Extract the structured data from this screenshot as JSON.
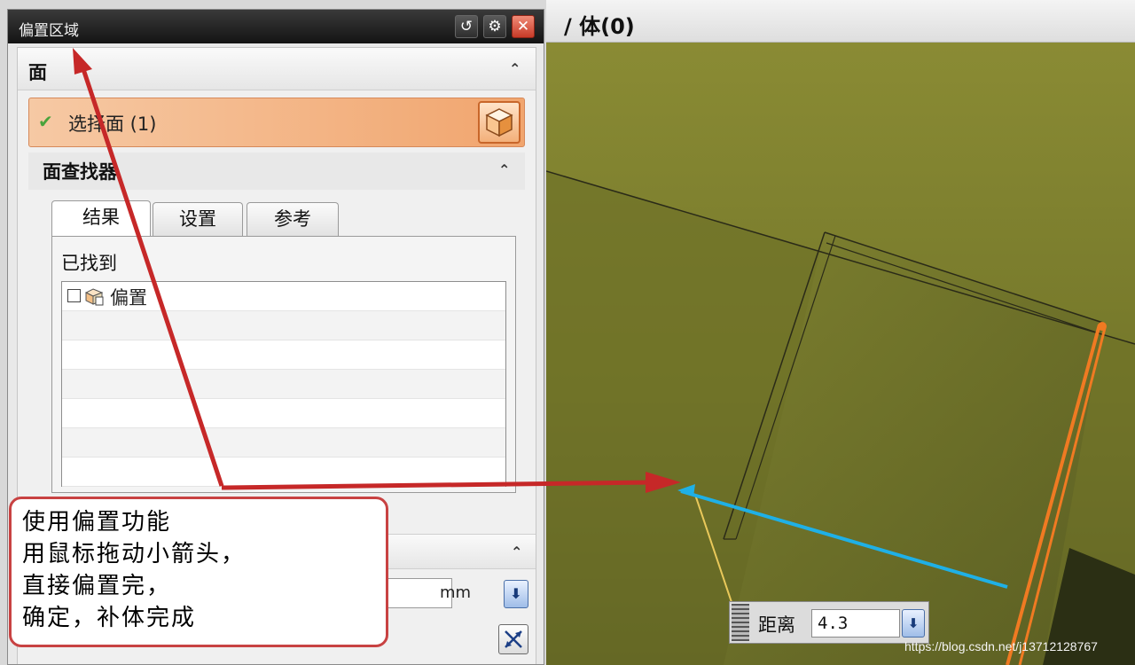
{
  "dialog": {
    "title": "偏置区域",
    "controls": {
      "reset_icon": "reset-icon",
      "settings_icon": "gear-icon",
      "close_icon": "close-icon"
    }
  },
  "face_section": {
    "title": "面",
    "select_face": {
      "label": "选择面 (1)",
      "check_icon": "check-icon",
      "button_icon": "cube-icon"
    },
    "face_finder": {
      "title": "面查找器",
      "tabs": [
        {
          "label": "结果",
          "selected": true
        },
        {
          "label": "设置",
          "selected": false
        },
        {
          "label": "参考",
          "selected": false
        }
      ],
      "found_label": "已找到",
      "results": [
        {
          "label": "偏置",
          "checked": false,
          "icon": "offset-face-icon"
        }
      ]
    }
  },
  "offset_section": {
    "unit": "mm"
  },
  "viewport": {
    "title": "/ 体(0)"
  },
  "distance_popup": {
    "label": "距离",
    "value": "4.3"
  },
  "annotation": {
    "lines": [
      "使用偏置功能",
      "用鼠标拖动小箭头，",
      "直接偏置完，",
      "确定，补体完成"
    ]
  },
  "watermark": "https://blog.csdn.net/j13712128767",
  "colors": {
    "annotation_red": "#c62828",
    "selected_edge_orange": "#f07a22",
    "handle_cyan": "#1fb0e6",
    "model_olive": "#7c7e2a"
  }
}
